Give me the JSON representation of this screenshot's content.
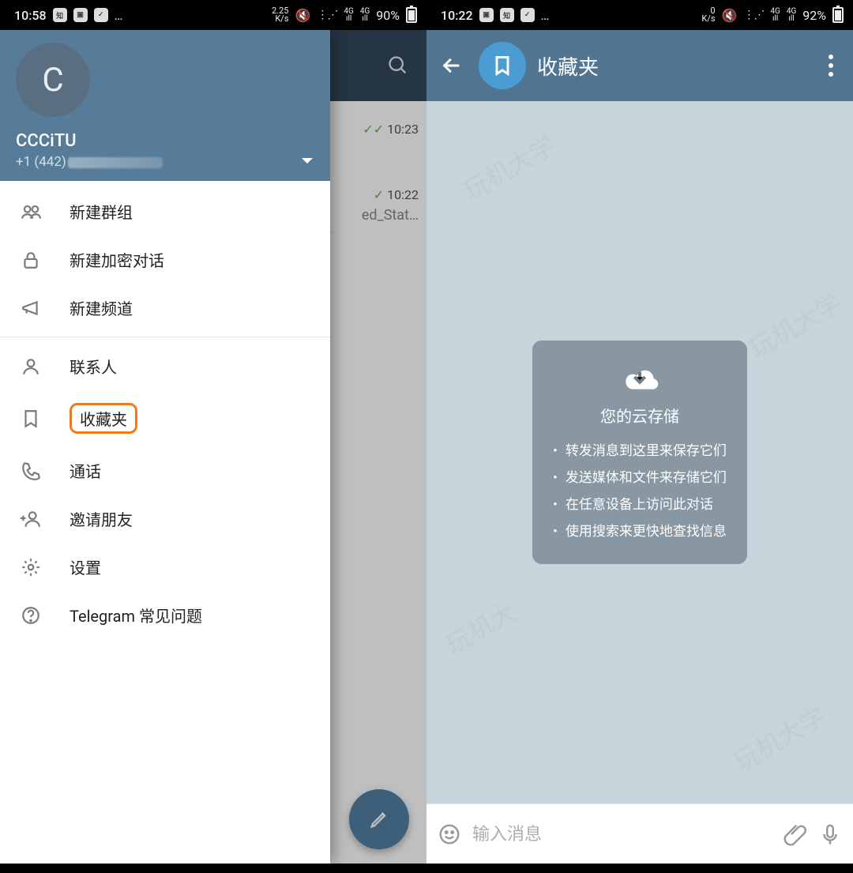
{
  "colors": {
    "tg_blue": "#527fa3",
    "highlight": "#f07a1e"
  },
  "left_phone": {
    "status": {
      "time": "10:58",
      "speed_top": "2.25",
      "speed_unit": "K/s",
      "battery": "90%",
      "net1": "4G",
      "net2": "4G"
    },
    "user": {
      "avatar_letter": "C",
      "name": "CCCiTU",
      "phone_prefix": "+1 (442)"
    },
    "menu": {
      "items": [
        {
          "icon": "group",
          "label": "新建群组"
        },
        {
          "icon": "lock",
          "label": "新建加密对话"
        },
        {
          "icon": "channel",
          "label": "新建频道"
        },
        {
          "divider": true
        },
        {
          "icon": "contact",
          "label": "联系人"
        },
        {
          "icon": "bookmark",
          "label": "收藏夹",
          "highlight": true
        },
        {
          "icon": "call",
          "label": "通话"
        },
        {
          "icon": "invite",
          "label": "邀请朋友"
        },
        {
          "icon": "settings",
          "label": "设置"
        },
        {
          "icon": "help",
          "label": "Telegram 常见问题"
        }
      ]
    },
    "chat_peek": {
      "time1": "10:23",
      "time2": "10:22",
      "text2": "ed_Stat…"
    }
  },
  "right_phone": {
    "status": {
      "time": "10:22",
      "speed_top": "0",
      "speed_unit": "K/s",
      "battery": "92%",
      "net1": "4G",
      "net2": "4G"
    },
    "header": {
      "title": "收藏夹"
    },
    "info_card": {
      "title": "您的云存储",
      "bullets": [
        "转发消息到这里来保存它们",
        "发送媒体和文件来存储它们",
        "在任意设备上访问此对话",
        "使用搜索来更快地查找信息"
      ]
    },
    "input": {
      "placeholder": "输入消息"
    }
  }
}
